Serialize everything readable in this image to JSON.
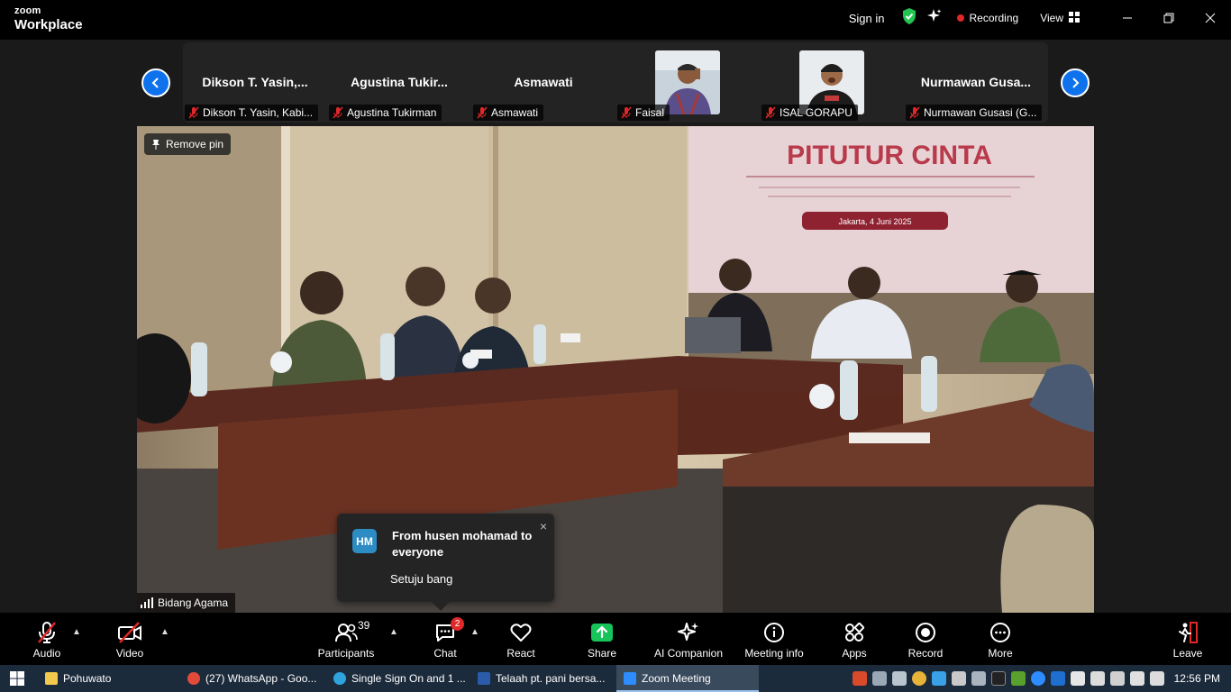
{
  "app": {
    "logo_line1": "zoom",
    "logo_line2": "Workplace",
    "sign_in": "Sign in",
    "recording": "Recording",
    "view": "View"
  },
  "filmstrip": [
    {
      "big_name": "Dikson T. Yasin,...",
      "label": "Dikson T. Yasin, Kabi..."
    },
    {
      "big_name": "Agustina Tukir...",
      "label": "Agustina Tukirman"
    },
    {
      "big_name": "Asmawati",
      "label": "Asmawati"
    },
    {
      "big_name": "",
      "label": "Faisal"
    },
    {
      "big_name": "",
      "label": "ISAL GORAPU"
    },
    {
      "big_name": "Nurmawan Gusa...",
      "label": "Nurmawan Gusasi (G..."
    }
  ],
  "main_video": {
    "pin_label": "Remove pin",
    "speaker": "Bidang Agama",
    "banner_title": "PITUTUR CINTA",
    "banner_date": "Jakarta, 4 Juni 2025"
  },
  "chat_toast": {
    "avatar": "HM",
    "from": "From husen mohamad to everyone",
    "message": "Setuju bang",
    "close": "×"
  },
  "toolbar": {
    "audio": "Audio",
    "video": "Video",
    "participants": "Participants",
    "participants_count": "39",
    "chat": "Chat",
    "chat_badge": "2",
    "react": "React",
    "share": "Share",
    "ai_companion": "AI Companion",
    "meeting_info": "Meeting info",
    "apps": "Apps",
    "record": "Record",
    "more": "More",
    "leave": "Leave"
  },
  "taskbar": {
    "items": [
      "Pohuwato",
      "(27) WhatsApp - Goo...",
      "Single Sign On and 1 ...",
      "Telaah pt. pani bersa...",
      "Zoom Meeting"
    ],
    "clock": "12:56 PM"
  },
  "colors": {
    "accent_blue": "#0e72ed",
    "record_red": "#e02828",
    "share_green": "#17c45a",
    "shield_green": "#23c552"
  }
}
